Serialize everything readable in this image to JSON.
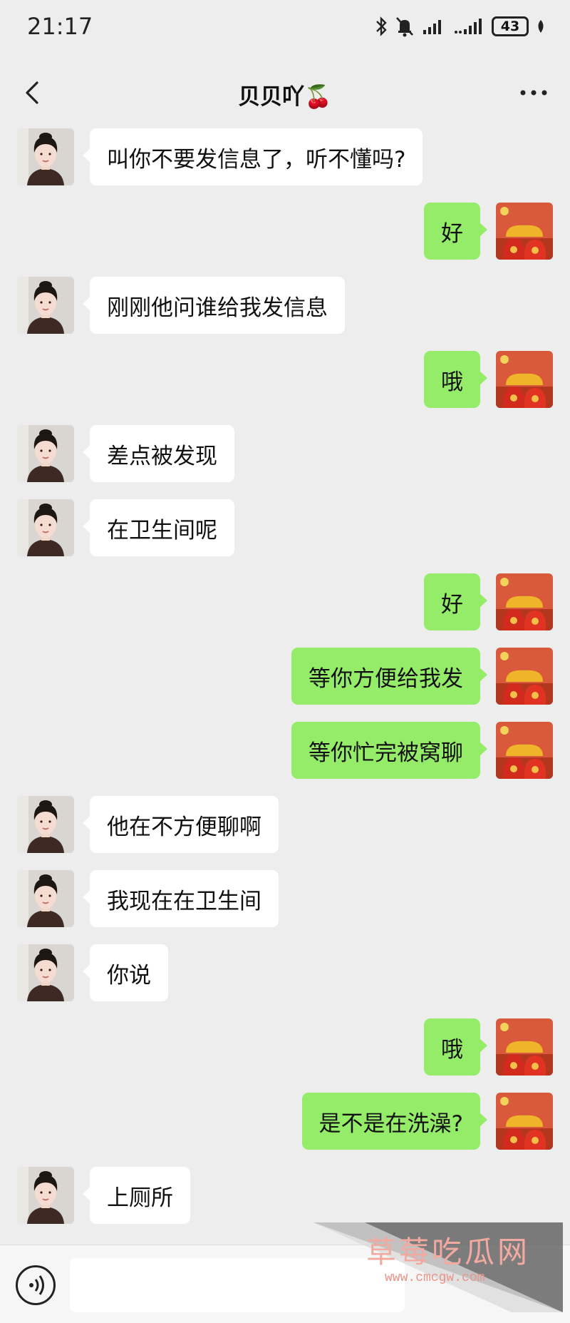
{
  "status": {
    "time": "21:17",
    "battery": "43"
  },
  "header": {
    "title": "贝贝吖🍒"
  },
  "messages": [
    {
      "side": "in",
      "text": "叫你不要发信息了，听不懂吗?"
    },
    {
      "side": "out",
      "text": "好"
    },
    {
      "side": "in",
      "text": "刚刚他问谁给我发信息"
    },
    {
      "side": "out",
      "text": "哦"
    },
    {
      "side": "in",
      "text": "差点被发现"
    },
    {
      "side": "in",
      "text": "在卫生间呢"
    },
    {
      "side": "out",
      "text": "好"
    },
    {
      "side": "out",
      "text": "等你方便给我发"
    },
    {
      "side": "out",
      "text": "等你忙完被窝聊"
    },
    {
      "side": "in",
      "text": "他在不方便聊啊"
    },
    {
      "side": "in",
      "text": "我现在在卫生间"
    },
    {
      "side": "in",
      "text": "你说"
    },
    {
      "side": "out",
      "text": "哦"
    },
    {
      "side": "out",
      "text": "是不是在洗澡?"
    },
    {
      "side": "in",
      "text": "上厕所"
    }
  ],
  "watermark": {
    "text": "草莓吃瓜网",
    "url": "www.cmcgw.com"
  },
  "colors": {
    "outgoing_bubble": "#95ec69",
    "incoming_bubble": "#ffffff",
    "background": "#ededed"
  }
}
